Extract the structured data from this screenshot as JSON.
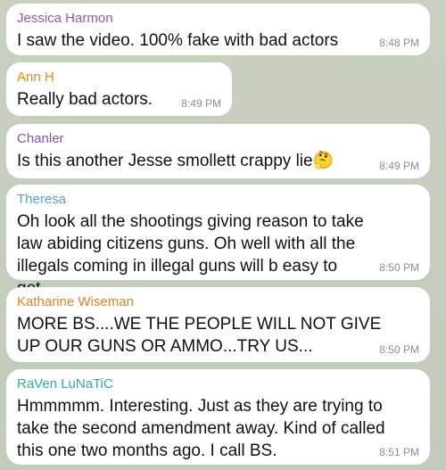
{
  "messages": [
    {
      "sender": "Jessica Harmon",
      "sender_color": "#8a5bb3",
      "text": "I saw the video. 100% fake with bad actors",
      "time": "8:48 PM"
    },
    {
      "sender": "Ann H",
      "sender_color": "#e08a1e",
      "text": "Really bad actors.",
      "time": "8:49 PM"
    },
    {
      "sender": "Chanler",
      "sender_color": "#7a58a8",
      "text": "Is this another Jesse smollett  crappy lie",
      "emoji": "🤔",
      "time": "8:49 PM"
    },
    {
      "sender": "Theresa",
      "sender_color": "#5a9fd0",
      "text": "Oh look all the shootings giving reason to take law abiding citizens guns. Oh well with all the illegals coming in illegal guns will b easy to get.",
      "time": "8:50 PM"
    },
    {
      "sender": "Katharine Wiseman",
      "sender_color": "#e0842a",
      "text": "MORE BS....WE THE PEOPLE WILL NOT GIVE UP OUR GUNS OR AMMO...TRY US...",
      "time": "8:50 PM"
    },
    {
      "sender": "RaVen LuNaTiC",
      "sender_color": "#3aa89a",
      "text": "Hmmmmm.  Interesting.   Just as they are trying to take the second amendment away.   Kind of called this one two months ago.  I call BS.",
      "time": "8:51 PM"
    }
  ]
}
